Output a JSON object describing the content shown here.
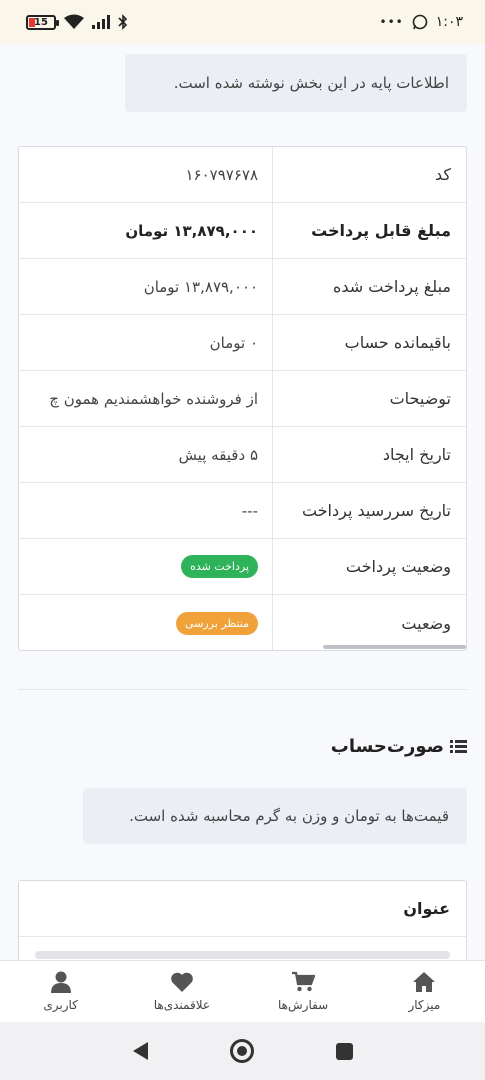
{
  "status_bar": {
    "time": "۱:۰۳",
    "dots": "•••",
    "battery_level": "15"
  },
  "info_box": {
    "text": "اطلاعات پایه در این بخش نوشته شده است."
  },
  "details": {
    "rows": [
      {
        "label": "کد",
        "value": "۱۶۰۷۹۷۶۷۸"
      },
      {
        "label": "مبلغ قابل پرداخت",
        "value": "۱۳,۸۷۹,۰۰۰ تومان"
      },
      {
        "label": "مبلغ پرداخت شده",
        "value": "۱۳,۸۷۹,۰۰۰ تومان"
      },
      {
        "label": "باقیمانده حساب",
        "value": "۰ تومان"
      },
      {
        "label": "توضیحات",
        "value": "از فروشنده خواهشمندیم همون چ"
      },
      {
        "label": "تاریخ ایجاد",
        "value": "۵ دقیقه پیش"
      },
      {
        "label": "تاریخ سررسید پرداخت",
        "value": "---"
      },
      {
        "label": "وضعیت پرداخت",
        "badge": "پرداخت شده"
      },
      {
        "label": "وضعیت",
        "badge": "منتظر بررسی"
      }
    ]
  },
  "invoice_section": {
    "title": "صورت‌حساب",
    "note": "قیمت‌ها به تومان و وزن به گرم محاسبه شده است.",
    "table_header": "عنوان"
  },
  "bottom_nav": {
    "items": [
      {
        "label": "میزکار",
        "icon": "home-icon"
      },
      {
        "label": "سفارش‌ها",
        "icon": "cart-icon"
      },
      {
        "label": "علاقمندی‌ها",
        "icon": "heart-icon"
      },
      {
        "label": "کاربری",
        "icon": "user-icon"
      }
    ]
  },
  "colors": {
    "paid_badge": "#2fb35a",
    "pending_badge": "#f0a13a",
    "info_bg": "#eceef6"
  }
}
